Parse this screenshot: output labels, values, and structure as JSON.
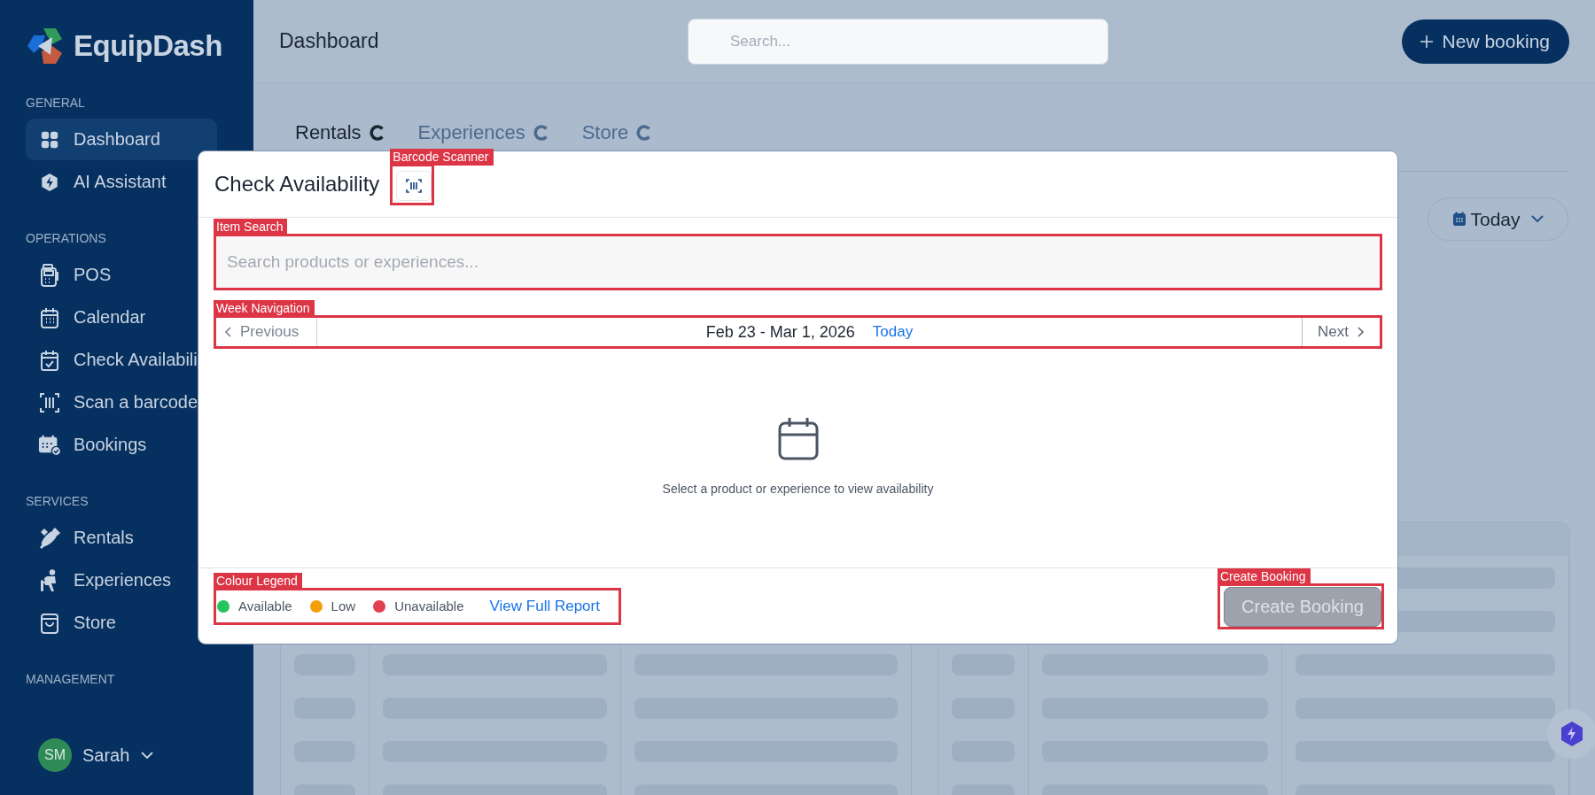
{
  "sidebar": {
    "brand": "EquipDash",
    "sections": [
      {
        "heading": "GENERAL",
        "items": [
          {
            "label": "Dashboard",
            "selected": true
          },
          {
            "label": "AI Assistant",
            "selected": false
          }
        ]
      },
      {
        "heading": "OPERATIONS",
        "items": [
          {
            "label": "POS",
            "selected": false
          },
          {
            "label": "Calendar",
            "selected": false
          },
          {
            "label": "Check Availabili",
            "selected": false
          },
          {
            "label": "Scan a barcode",
            "selected": false
          },
          {
            "label": "Bookings",
            "selected": false
          }
        ]
      },
      {
        "heading": "SERVICES",
        "items": [
          {
            "label": "Rentals",
            "selected": false
          },
          {
            "label": "Experiences",
            "selected": false
          },
          {
            "label": "Store",
            "selected": false
          }
        ]
      },
      {
        "heading": "MANAGEMENT"
      }
    ],
    "user": {
      "initials": "SM",
      "name": "Sarah"
    }
  },
  "header": {
    "title": "Dashboard",
    "search": {
      "placeholder": "Search..."
    },
    "new_booking": "New booking"
  },
  "tabs": [
    {
      "label": "Rentals",
      "selected": true
    },
    {
      "label": "Experiences",
      "selected": false
    },
    {
      "label": "Store",
      "selected": false
    }
  ],
  "date_filter": "Today",
  "modal": {
    "title": "Check Availability",
    "scanner": {
      "annotation": "Barcode Scanner"
    },
    "search": {
      "annotation": "Item Search",
      "placeholder": "Search products or experiences..."
    },
    "week": {
      "annotation": "Week Navigation",
      "previous": "Previous",
      "range": "Feb 23 - Mar 1, 2026",
      "today": "Today",
      "next": "Next"
    },
    "empty_message": "Select a product or experience to view availability",
    "legend": {
      "annotation": "Colour Legend",
      "items": [
        {
          "label": "Available",
          "color": "#22c55e"
        },
        {
          "label": "Low",
          "color": "#f59e0b"
        },
        {
          "label": "Unavailable",
          "color": "#e0404f"
        }
      ],
      "report_link": "View Full Report"
    },
    "create": {
      "annotation": "Create Booking",
      "label": "Create Booking",
      "disabled": true
    }
  }
}
